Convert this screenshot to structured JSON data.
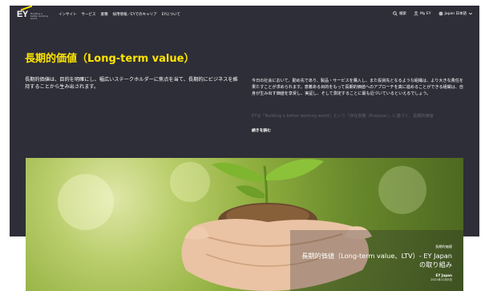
{
  "nav": {
    "logo": "EY",
    "logo_tagline": "Building a better working world",
    "links": [
      "インサイト",
      "サービス",
      "業種",
      "採用情報／EYでのキャリア",
      "EYについて"
    ],
    "search": "検索",
    "my_ey": "My EY",
    "language": "Japan 日本語"
  },
  "hero": {
    "title": "長期的価値（Long-term value）",
    "lead": "長期的価値は、目的を明確にし、幅広いステークホルダーに焦点を当て、長期的にビジネスを維持することから生み出されます。",
    "body": "今日の社会において、勤め先であり、製品・サービスを購入し、また投資先となるような組織は、より大きな責任を果たすことが求められます。意義ある目的をもって長期的価値へのアプローチを真に進めることができる組織は、自身が生み出す価値を享受し、実証し、そして測定することに最も近づいているといえるでしょう。",
    "body_faded": "EYは「Building a better working world」という「存在意義（Purpose）」に基づく、長期的価値",
    "read_more": "続きを読む"
  },
  "feature": {
    "kicker": "長期的価値",
    "title_line1": "長期的価値（Long-term value、LTV）- EY Japan",
    "title_line2": "の取り組み",
    "source": "EY Japan",
    "date": "2021年11月5日"
  },
  "colors": {
    "dark_bg": "#2e2e38",
    "accent_yellow": "#ffe600"
  }
}
